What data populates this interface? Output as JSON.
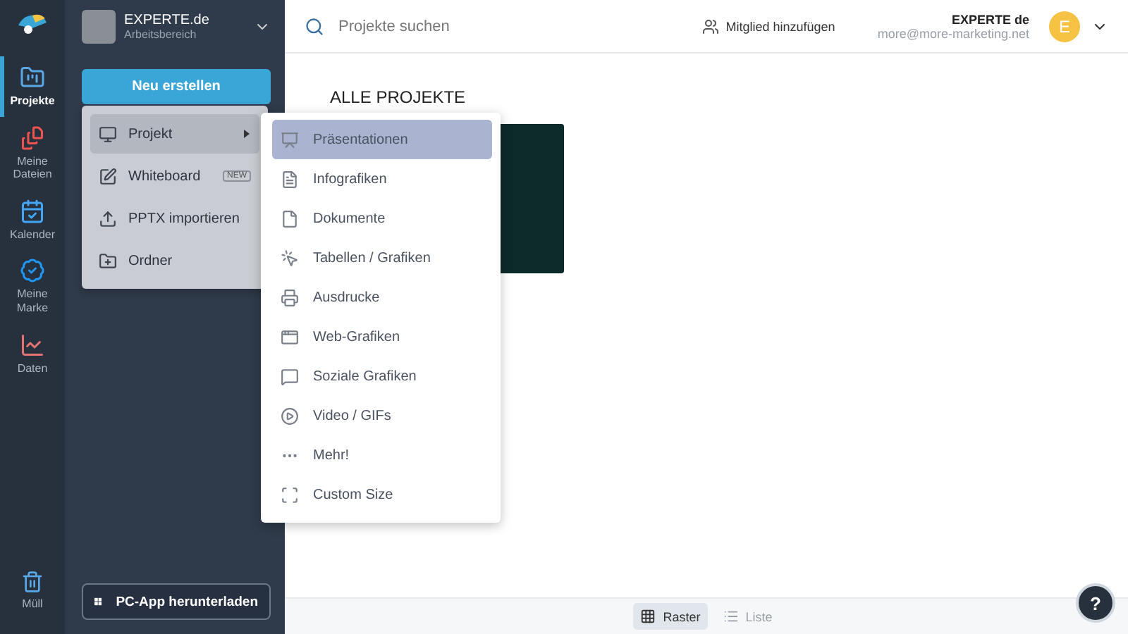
{
  "rail": {
    "items": [
      {
        "label": "Projekte",
        "selected": true
      },
      {
        "label": "Meine Dateien",
        "selected": false
      },
      {
        "label": "Kalender",
        "selected": false
      },
      {
        "label": "Meine Marke",
        "selected": false
      },
      {
        "label": "Daten",
        "selected": false
      }
    ],
    "trash": "Müll"
  },
  "workspace": {
    "name": "EXPERTE.de",
    "subtitle": "Arbeitsbereich"
  },
  "create_button": "Neu erstellen",
  "download_button": "PC-App herunterladen",
  "search": {
    "placeholder": "Projekte suchen"
  },
  "add_member": "Mitglied hinzufügen",
  "user": {
    "name": "EXPERTE de",
    "email": "more@more-marketing.net",
    "initial": "E"
  },
  "heading": "ALLE PROJEKTE",
  "create_menu": {
    "items": [
      {
        "label": "Projekt",
        "selected": true,
        "has_submenu": true
      },
      {
        "label": "Whiteboard",
        "selected": false,
        "badge": "NEW"
      },
      {
        "label": "PPTX importieren",
        "selected": false
      },
      {
        "label": "Ordner",
        "selected": false
      }
    ]
  },
  "submenu": {
    "items": [
      {
        "label": "Präsentationen",
        "selected": true
      },
      {
        "label": "Infografiken",
        "selected": false
      },
      {
        "label": "Dokumente",
        "selected": false
      },
      {
        "label": "Tabellen / Grafiken",
        "selected": false
      },
      {
        "label": "Ausdrucke",
        "selected": false
      },
      {
        "label": "Web-Grafiken",
        "selected": false
      },
      {
        "label": "Soziale Grafiken",
        "selected": false
      },
      {
        "label": "Video / GIFs",
        "selected": false
      },
      {
        "label": "Mehr!",
        "selected": false
      },
      {
        "label": "Custom Size",
        "selected": false
      }
    ]
  },
  "view_toggle": [
    {
      "label": "Raster",
      "selected": true
    },
    {
      "label": "Liste",
      "selected": false
    }
  ],
  "help": "?"
}
